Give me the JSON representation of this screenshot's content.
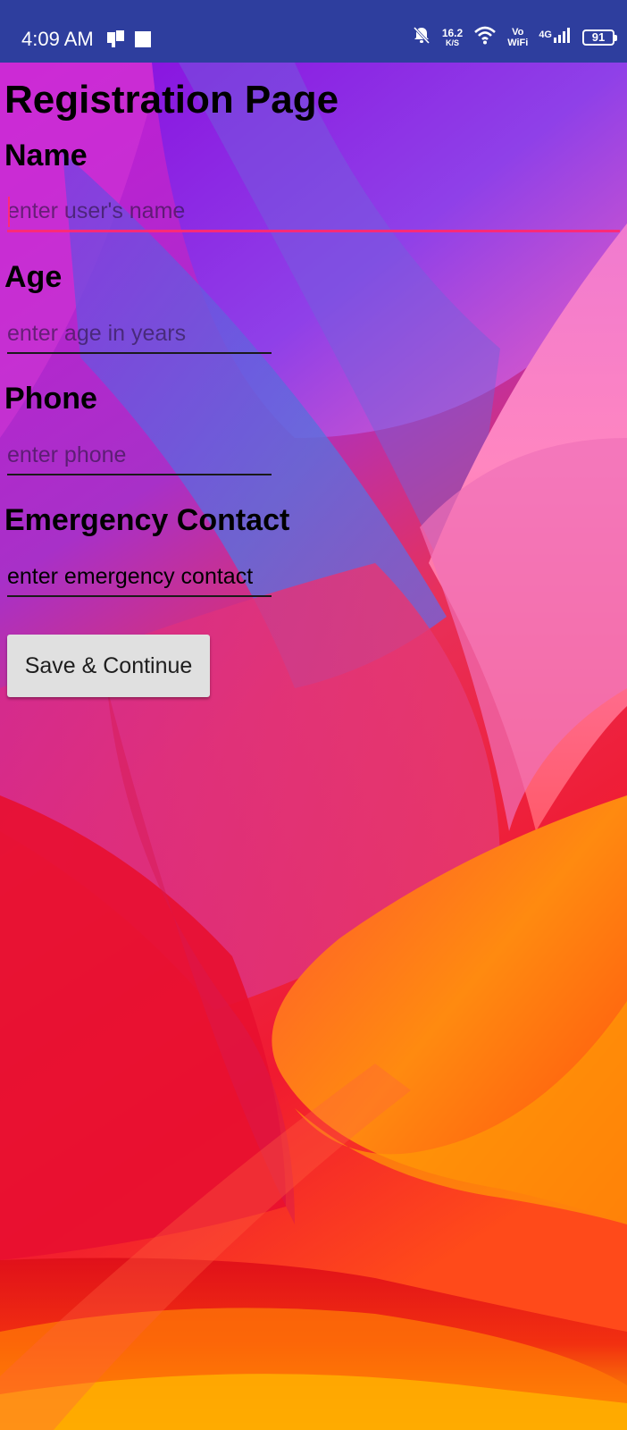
{
  "status_bar": {
    "time": "4:09 AM",
    "net_speed_value": "16.2",
    "net_speed_unit": "K/S",
    "vowifi_top": "Vo",
    "vowifi_bottom": "WiFi",
    "network_type": "4G",
    "battery_level": "91",
    "icons": [
      "notification-app-icon",
      "stop-square-icon",
      "bell-muted-icon",
      "wifi-icon",
      "signal-bars-icon",
      "battery-icon"
    ]
  },
  "colors": {
    "status_bar_bg": "#2e3e9e",
    "focus_accent": "#ff2a78",
    "button_bg": "#e0e0e0",
    "text": "#000000"
  },
  "form": {
    "title": "Registration Page",
    "fields": [
      {
        "label": "Name",
        "placeholder": "enter user's name",
        "value": ""
      },
      {
        "label": "Age",
        "placeholder": "enter age in years",
        "value": ""
      },
      {
        "label": "Phone",
        "placeholder": "enter phone",
        "value": ""
      },
      {
        "label": "Emergency Contact",
        "placeholder": "",
        "value": "enter emergency contact"
      }
    ],
    "submit_label": "Save & Continue"
  }
}
